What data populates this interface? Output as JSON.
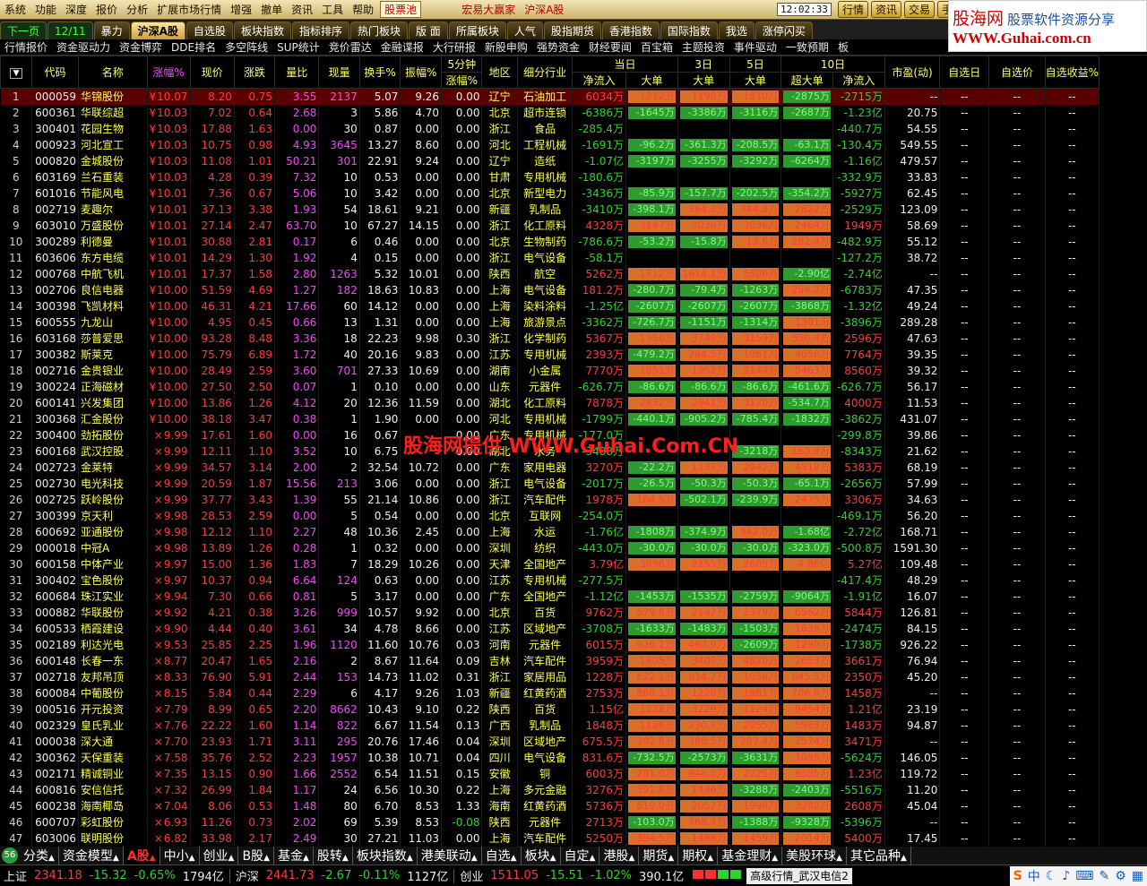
{
  "menu": [
    "系统",
    "功能",
    "深度",
    "报价",
    "分析",
    "扩展市场行情",
    "增强",
    "撤单",
    "资讯",
    "工具",
    "帮助"
  ],
  "menu_pool": "股票池",
  "menu_marquee": [
    "宏易大赢家",
    "沪深A股"
  ],
  "clock": "12:02:33",
  "menu_buttons": [
    "行情",
    "资讯",
    "交易",
    "手机"
  ],
  "logo": {
    "cn": "股海网",
    "slogan": "股票软件资源分享",
    "url": "WWW.Guhai.com.cn"
  },
  "tabs": [
    {
      "label": "下一页",
      "s": "green"
    },
    {
      "label": "12/11",
      "s": "green"
    },
    {
      "label": "暴力",
      "s": ""
    },
    {
      "label": "沪深A股",
      "s": "act"
    },
    {
      "label": "自选股",
      "s": ""
    },
    {
      "label": "板块指数",
      "s": ""
    },
    {
      "label": "指标排序",
      "s": ""
    },
    {
      "label": "热门板块",
      "s": ""
    },
    {
      "label": "版 面",
      "s": ""
    },
    {
      "label": "所属板块",
      "s": ""
    },
    {
      "label": "人气",
      "s": ""
    },
    {
      "label": "股指期货",
      "s": ""
    },
    {
      "label": "香港指数",
      "s": ""
    },
    {
      "label": "国际指数",
      "s": ""
    },
    {
      "label": "我选",
      "s": ""
    },
    {
      "label": "涨停闪买",
      "s": ""
    }
  ],
  "subtabs": [
    "行情报价",
    "资金驱动力",
    "资金博弈",
    "DDE排名",
    "多空阵线",
    "SUP统计",
    "竞价雷达",
    "金融谍报",
    "大行研报",
    "新股申购",
    "强势资金",
    "财经要闻",
    "百宝箱",
    "主题投资",
    "事件驱动",
    "一致预期",
    "板"
  ],
  "columns": {
    "h1": [
      "",
      "代码",
      "名称",
      "涨幅%",
      "现价",
      "涨跌",
      "量比",
      "现量",
      "换手%",
      "振幅%",
      "5分钟",
      "地区",
      "细分行业",
      "当日",
      "3日",
      "5日",
      "10日",
      "市盈(动)",
      "自选日",
      "自选价",
      "自选收益%"
    ],
    "h2": [
      "涨幅%",
      "净流入",
      "大单",
      "大单",
      "大单",
      "超大单",
      "净流入"
    ]
  },
  "rows": [
    [
      "1",
      "000059",
      "华锦股份",
      "10.07",
      "8.20",
      "0.75",
      "3.55",
      "2137",
      "5.07",
      "9.26",
      "0.00",
      "辽宁",
      "石油加工",
      "6034万",
      "1212万",
      "1198万",
      "1810万",
      "-2875万",
      "-2715万",
      "--",
      "1"
    ],
    [
      "2",
      "600361",
      "华联综超",
      "10.03",
      "7.02",
      "0.64",
      "2.68",
      "3",
      "5.86",
      "4.70",
      "0.00",
      "北京",
      "超市连锁",
      "-6386万",
      "-1645万",
      "-3386万",
      "-3116万",
      "-2687万",
      "-1.23亿",
      "20.75",
      "0"
    ],
    [
      "3",
      "300401",
      "花园生物",
      "10.03",
      "17.88",
      "1.63",
      "0.00",
      "30",
      "0.87",
      "0.00",
      "0.00",
      "浙江",
      "食品",
      "-285.4万",
      "",
      "",
      "",
      "",
      "-440.7万",
      "54.55",
      "0"
    ],
    [
      "4",
      "000923",
      "河北宣工",
      "10.03",
      "10.75",
      "0.98",
      "4.93",
      "3645",
      "13.27",
      "8.60",
      "0.00",
      "河北",
      "工程机械",
      "-1691万",
      "-96.2万",
      "-361.3万",
      "-208.5万",
      "-63.1万",
      "-130.4万",
      "549.55",
      "0"
    ],
    [
      "5",
      "000820",
      "金城股份",
      "10.03",
      "11.08",
      "1.01",
      "50.21",
      "301",
      "22.91",
      "9.24",
      "0.00",
      "辽宁",
      "造纸",
      "-1.07亿",
      "-3197万",
      "-3255万",
      "-3292万",
      "-6264万",
      "-1.16亿",
      "479.57",
      "0"
    ],
    [
      "6",
      "603169",
      "兰石重装",
      "10.03",
      "4.28",
      "0.39",
      "7.32",
      "10",
      "0.53",
      "0.00",
      "0.00",
      "甘肃",
      "专用机械",
      "-180.6万",
      "",
      "",
      "",
      "",
      "-332.9万",
      "33.83",
      "0"
    ],
    [
      "7",
      "601016",
      "节能风电",
      "10.01",
      "7.36",
      "0.67",
      "5.06",
      "10",
      "3.42",
      "0.00",
      "0.00",
      "北京",
      "新型电力",
      "-3436万",
      "-85.9万",
      "-157.7万",
      "-202.5万",
      "-354.2万",
      "-5927万",
      "62.45",
      "0"
    ],
    [
      "8",
      "002719",
      "麦趣尔",
      "10.01",
      "37.13",
      "3.38",
      "1.93",
      "54",
      "18.61",
      "9.21",
      "0.00",
      "新疆",
      "乳制品",
      "-3410万",
      "-398.1万",
      "364.3万",
      "344.8万",
      "2822万",
      "-2529万",
      "123.09",
      "0"
    ],
    [
      "9",
      "603010",
      "万盛股份",
      "10.01",
      "27.14",
      "2.47",
      "63.70",
      "10",
      "67.27",
      "14.15",
      "0.00",
      "浙江",
      "化工原料",
      "4328万",
      "3147万",
      "3036万",
      "3036万",
      "2464万",
      "1949万",
      "58.69",
      "0"
    ],
    [
      "10",
      "300289",
      "利德曼",
      "10.01",
      "30.88",
      "2.81",
      "0.17",
      "6",
      "0.46",
      "0.00",
      "0.00",
      "北京",
      "生物制药",
      "-786.6万",
      "-53.2万",
      "-15.8万",
      "13.6万",
      "282.4万",
      "-482.9万",
      "55.12",
      "0"
    ],
    [
      "11",
      "603606",
      "东方电缆",
      "10.01",
      "14.29",
      "1.30",
      "1.92",
      "4",
      "0.15",
      "0.00",
      "0.00",
      "浙江",
      "电气设备",
      "-58.1万",
      "",
      "",
      "",
      "",
      "-127.2万",
      "38.72",
      "0"
    ],
    [
      "12",
      "000768",
      "中航飞机",
      "10.01",
      "17.37",
      "1.58",
      "2.80",
      "1263",
      "5.32",
      "10.01",
      "0.00",
      "陕西",
      "航空",
      "5262万",
      "1712万",
      "1614.1万",
      "5506万",
      "-2.90亿",
      "-2.74亿",
      "--",
      "0"
    ],
    [
      "13",
      "002706",
      "良信电器",
      "10.00",
      "51.59",
      "4.69",
      "1.27",
      "182",
      "18.63",
      "10.83",
      "0.00",
      "上海",
      "电气设备",
      "181.2万",
      "-280.7万",
      "-79.4万",
      "-1263万",
      "254.2万",
      "-6783万",
      "47.35",
      "0"
    ],
    [
      "14",
      "300398",
      "飞凯材料",
      "10.00",
      "46.31",
      "4.21",
      "17.66",
      "60",
      "14.12",
      "0.00",
      "0.00",
      "上海",
      "染料涂料",
      "-1.25亿",
      "-2607万",
      "-2607万",
      "-2607万",
      "-3868万",
      "-1.32亿",
      "49.24",
      "0"
    ],
    [
      "15",
      "600555",
      "九龙山",
      "10.00",
      "4.95",
      "0.45",
      "0.66",
      "13",
      "1.31",
      "0.00",
      "0.00",
      "上海",
      "旅游景点",
      "-3362万",
      "-726.7万",
      "-1151万",
      "-1314万",
      "1301万",
      "-3896万",
      "289.28",
      "0"
    ],
    [
      "16",
      "603168",
      "莎普爱思",
      "10.00",
      "93.28",
      "8.48",
      "3.36",
      "18",
      "22.23",
      "9.98",
      "0.30",
      "浙江",
      "化学制药",
      "5367万",
      "1350万",
      "3749万",
      "3159万",
      "550.4万",
      "2596万",
      "47.63",
      "0"
    ],
    [
      "17",
      "300382",
      "斯莱克",
      "10.00",
      "75.79",
      "6.89",
      "1.72",
      "40",
      "20.16",
      "9.83",
      "0.00",
      "江苏",
      "专用机械",
      "2393万",
      "-479.2万",
      "284.5万",
      "1061万",
      "4056万",
      "7764万",
      "39.35",
      "0"
    ],
    [
      "18",
      "002716",
      "金贵银业",
      "10.00",
      "28.49",
      "2.59",
      "3.60",
      "701",
      "27.33",
      "10.69",
      "0.00",
      "湖南",
      "小金属",
      "7770万",
      "1851万",
      "1952万",
      "2144万",
      "5463万",
      "8560万",
      "39.32",
      "0"
    ],
    [
      "19",
      "300224",
      "正海磁材",
      "10.00",
      "27.50",
      "2.50",
      "0.07",
      "1",
      "0.10",
      "0.00",
      "0.00",
      "山东",
      "元器件",
      "-626.7万",
      "-86.6万",
      "-86.6万",
      "-86.6万",
      "-461.6万",
      "-626.7万",
      "56.17",
      "0"
    ],
    [
      "20",
      "600141",
      "兴发集团",
      "10.00",
      "13.86",
      "1.26",
      "4.12",
      "20",
      "12.36",
      "11.59",
      "0.00",
      "湖北",
      "化工原料",
      "7878万",
      "2832万",
      "2941万",
      "3120万",
      "-534.7万",
      "4000万",
      "11.53",
      "0"
    ],
    [
      "21",
      "300368",
      "汇金股份",
      "10.00",
      "38.18",
      "3.47",
      "0.38",
      "1",
      "1.90",
      "0.00",
      "0.00",
      "河北",
      "专用机械",
      "-1799万",
      "-440.1万",
      "-905.2万",
      "-785.4万",
      "-1832万",
      "-3862万",
      "431.07",
      "0"
    ],
    [
      "22",
      "300400",
      "劲拓股份",
      "9.99",
      "17.61",
      "1.60",
      "0.00",
      "16",
      "0.67",
      "",
      "0.00",
      "广东",
      "专用机械",
      "-177.0万",
      "",
      "",
      "",
      "",
      "-299.8万",
      "39.86",
      "0"
    ],
    [
      "23",
      "600168",
      "武汉控股",
      "9.99",
      "12.11",
      "1.10",
      "3.52",
      "10",
      "6.75",
      "",
      "0.00",
      "湖北",
      "水务",
      "-3488万",
      "",
      "",
      "-3218万",
      "163.9万",
      "-8343万",
      "21.62",
      "0"
    ],
    [
      "24",
      "002723",
      "金莱特",
      "9.99",
      "34.57",
      "3.14",
      "2.00",
      "2",
      "32.54",
      "10.72",
      "0.00",
      "广东",
      "家用电器",
      "3270万",
      "-22.2万",
      "1137万",
      "2042万",
      "4319万",
      "5383万",
      "68.19",
      "0"
    ],
    [
      "25",
      "002730",
      "电光科技",
      "9.99",
      "20.59",
      "1.87",
      "15.56",
      "213",
      "3.06",
      "0.00",
      "0.00",
      "浙江",
      "电气设备",
      "-2017万",
      "-26.5万",
      "-50.3万",
      "-50.3万",
      "-65.1万",
      "-2656万",
      "57.99",
      "0"
    ],
    [
      "26",
      "002725",
      "跃岭股份",
      "9.99",
      "37.77",
      "3.43",
      "1.39",
      "55",
      "21.14",
      "10.86",
      "0.00",
      "浙江",
      "汽车配件",
      "1978万",
      "164.5万",
      "-502.1万",
      "-239.9万",
      "2475万",
      "3306万",
      "34.63",
      "0"
    ],
    [
      "27",
      "300399",
      "京天利",
      "9.98",
      "28.53",
      "2.59",
      "0.00",
      "5",
      "0.54",
      "0.00",
      "0.00",
      "北京",
      "互联网",
      "-254.0万",
      "",
      "",
      "",
      "",
      "-469.1万",
      "56.20",
      "0"
    ],
    [
      "28",
      "600692",
      "亚通股份",
      "9.98",
      "12.12",
      "1.10",
      "2.27",
      "48",
      "10.36",
      "2.45",
      "0.00",
      "上海",
      "水运",
      "-1.76亿",
      "-1808万",
      "-374.9万",
      "942.0万",
      "-1.68亿",
      "-2.72亿",
      "168.71",
      "0"
    ],
    [
      "29",
      "000018",
      "中冠A",
      "9.98",
      "13.89",
      "1.26",
      "0.28",
      "1",
      "0.32",
      "0.00",
      "0.00",
      "深圳",
      "纺织",
      "-443.0万",
      "-30.0万",
      "-30.0万",
      "-30.0万",
      "-323.0万",
      "-500.8万",
      "1591.30",
      "0"
    ],
    [
      "30",
      "600158",
      "中体产业",
      "9.97",
      "15.00",
      "1.36",
      "1.83",
      "7",
      "18.29",
      "10.26",
      "0.00",
      "天津",
      "全国地产",
      "3.79亿",
      "3096万",
      "2155万",
      "2605万",
      "4.88亿",
      "5.27亿",
      "109.48",
      "0"
    ],
    [
      "31",
      "300402",
      "宝色股份",
      "9.97",
      "10.37",
      "0.94",
      "6.64",
      "124",
      "0.63",
      "0.00",
      "0.00",
      "江苏",
      "专用机械",
      "-277.5万",
      "",
      "",
      "",
      "",
      "-417.4万",
      "48.29",
      "0"
    ],
    [
      "32",
      "600684",
      "珠江实业",
      "9.94",
      "7.30",
      "0.66",
      "0.81",
      "5",
      "3.17",
      "0.00",
      "0.00",
      "广东",
      "全国地产",
      "-1.12亿",
      "-1453万",
      "-1535万",
      "-2759万",
      "-9064万",
      "-1.91亿",
      "16.07",
      "0"
    ],
    [
      "33",
      "000882",
      "华联股份",
      "9.92",
      "4.21",
      "0.38",
      "3.26",
      "999",
      "10.57",
      "9.92",
      "0.00",
      "北京",
      "百货",
      "9762万",
      "579.8万",
      "2142万",
      "2379万",
      "6562万",
      "5844万",
      "126.81",
      "0"
    ],
    [
      "34",
      "600533",
      "栖霞建设",
      "9.90",
      "4.44",
      "0.40",
      "3.61",
      "34",
      "4.78",
      "8.66",
      "0.00",
      "江苏",
      "区域地产",
      "-3708万",
      "-1633万",
      "-1483万",
      "-1503万",
      "1639万",
      "-2474万",
      "84.15",
      "0"
    ],
    [
      "35",
      "002189",
      "利达光电",
      "9.53",
      "25.85",
      "2.25",
      "1.96",
      "1120",
      "11.60",
      "10.76",
      "0.03",
      "河南",
      "元器件",
      "6015万",
      "936.1万",
      "497.9万",
      "-2609万",
      "1290万",
      "-1738万",
      "926.22",
      "0"
    ],
    [
      "36",
      "600148",
      "长春一东",
      "8.77",
      "20.47",
      "1.65",
      "2.16",
      "2",
      "8.67",
      "11.64",
      "0.09",
      "吉林",
      "汽车配件",
      "3959万",
      "1805万",
      "3409万",
      "4820万",
      "2653万",
      "3661万",
      "76.94",
      "0"
    ],
    [
      "37",
      "002718",
      "友邦吊顶",
      "8.33",
      "76.90",
      "5.91",
      "2.44",
      "153",
      "14.73",
      "11.02",
      "0.31",
      "浙江",
      "家居用品",
      "1228万",
      "622.1万",
      "814.7万",
      "1058万",
      "645.5万",
      "2350万",
      "45.20",
      "0"
    ],
    [
      "38",
      "600084",
      "中葡股份",
      "8.15",
      "5.84",
      "0.44",
      "2.29",
      "6",
      "4.17",
      "9.26",
      "1.03",
      "新疆",
      "红黄药酒",
      "2753万",
      "880.1万",
      "1228万",
      "1981万",
      "706.6万",
      "1458万",
      "--",
      "0"
    ],
    [
      "39",
      "000516",
      "开元投资",
      "7.79",
      "8.99",
      "0.65",
      "2.20",
      "8662",
      "10.43",
      "9.10",
      "0.22",
      "陕西",
      "百货",
      "1.15亿",
      "1228万",
      "3229万",
      "1124万",
      "9454万",
      "1.21亿",
      "23.19",
      "0"
    ],
    [
      "40",
      "002329",
      "皇氏乳业",
      "7.76",
      "22.22",
      "1.60",
      "1.14",
      "822",
      "6.67",
      "11.54",
      "0.13",
      "广西",
      "乳制品",
      "1848万",
      "1126万",
      "230.8万",
      "2055万",
      "5963万",
      "1483万",
      "94.87",
      "0"
    ],
    [
      "41",
      "000038",
      "深大通",
      "7.70",
      "23.93",
      "1.71",
      "3.11",
      "295",
      "20.76",
      "17.46",
      "0.04",
      "深圳",
      "区域地产",
      "675.5万",
      "302.8万",
      "388.5万",
      "287.4万",
      "2574万",
      "3471万",
      "--",
      "0"
    ],
    [
      "42",
      "300362",
      "天保重装",
      "7.58",
      "35.76",
      "2.52",
      "2.23",
      "1957",
      "10.38",
      "10.71",
      "0.04",
      "四川",
      "电气设备",
      "831.6万",
      "-732.5万",
      "-2573万",
      "-3631万",
      "1095万",
      "-5624万",
      "146.05",
      "0"
    ],
    [
      "43",
      "002171",
      "精诚铜业",
      "7.35",
      "13.15",
      "0.90",
      "1.66",
      "2552",
      "6.54",
      "11.51",
      "0.15",
      "安徽",
      "铜",
      "6003万",
      "281.0万",
      "848.3万",
      "2725万",
      "6585万",
      "1.23亿",
      "119.72",
      "0"
    ],
    [
      "44",
      "600816",
      "安信信托",
      "7.32",
      "26.99",
      "1.84",
      "1.17",
      "24",
      "6.56",
      "10.30",
      "0.22",
      "上海",
      "多元金融",
      "3276万",
      "391.6万",
      "1496万",
      "-3288万",
      "-2403万",
      "-5516万",
      "11.20",
      "0"
    ],
    [
      "45",
      "600238",
      "海南椰岛",
      "7.04",
      "8.06",
      "0.53",
      "1.48",
      "80",
      "6.70",
      "8.53",
      "1.33",
      "海南",
      "红黄药酒",
      "5736万",
      "619.0万",
      "2057万",
      "1998万",
      "3282万",
      "2608万",
      "45.04",
      "0"
    ],
    [
      "46",
      "600707",
      "彩虹股份",
      "6.93",
      "11.26",
      "0.73",
      "2.02",
      "69",
      "5.39",
      "8.53",
      "-0.08",
      "陕西",
      "元器件",
      "2713万",
      "-103.0万",
      "768.7万",
      "-1388万",
      "-9328万",
      "-5396万",
      "--",
      "0"
    ],
    [
      "47",
      "603006",
      "联明股份",
      "6.82",
      "33.98",
      "2.17",
      "2.49",
      "30",
      "27.21",
      "11.03",
      "0.00",
      "上海",
      "汽车配件",
      "5250万",
      "394.5万",
      "1488万",
      "1459万",
      "2014万",
      "5400万",
      "17.45",
      "0"
    ]
  ],
  "watermark": "股海网提供 WWW.Guhai.Com.CN",
  "bottom_tabs": [
    "分类",
    "资金模型",
    "A股",
    "中小",
    "创业",
    "B股",
    "基金",
    "股转",
    "板块指数",
    "港美联动",
    "自选",
    "板块",
    "自定",
    "港股",
    "期货",
    "期权",
    "基金理财",
    "美股环球",
    "其它品种"
  ],
  "bottom_badge": "56",
  "status": {
    "idx1_name": "上证",
    "idx1_val": "2341.18",
    "idx1_chg": "-15.32",
    "idx1_pct": "-0.65%",
    "idx1_amt": "1794亿",
    "idx2_name": "沪深",
    "idx2_val": "2441.73",
    "idx2_chg": "-2.67",
    "idx2_pct": "-0.11%",
    "idx2_amt": "1127亿",
    "idx3_name": "创业",
    "idx3_val": "1511.05",
    "idx3_chg": "-15.51",
    "idx3_pct": "-1.02%",
    "idx3_amt": "390.1亿",
    "server": "高级行情_武汉电信2",
    "icons": [
      "中",
      "☾",
      "♪",
      "⌨",
      "✎",
      "⚙",
      "▦"
    ]
  }
}
